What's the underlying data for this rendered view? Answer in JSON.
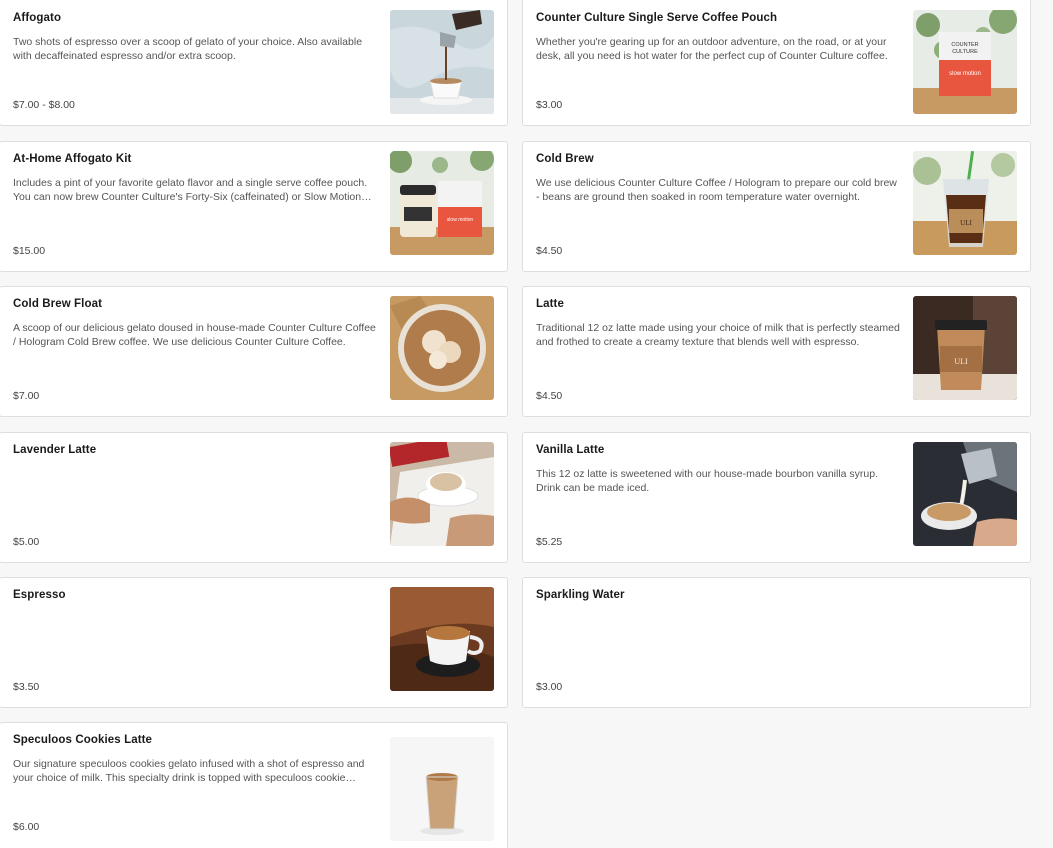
{
  "menu": {
    "items": [
      {
        "name": "Affogato",
        "description": "Two shots of espresso over a scoop of gelato of your choice. Also available with decaffeinated espresso and/or extra scoop.",
        "price": "$7.00 - $8.00",
        "image": "affogato-photo"
      },
      {
        "name": "Counter Culture Single Serve Coffee Pouch",
        "description": "Whether you're gearing up for an outdoor adventure, on the road, or at your desk, all you need is hot water for the perfect cup of Counter Culture coffee.",
        "price": "$3.00",
        "image": "coffee-pouch-photo",
        "image_text": [
          "COUNTER",
          "CULTURE",
          "slow motion"
        ]
      },
      {
        "name": "At-Home Affogato Kit",
        "description": "Includes a pint of your favorite gelato flavor and a single serve coffee pouch. You can now brew Counter Culture's Forty-Six (caffeinated) or Slow Motion (decaf).",
        "price": "$15.00",
        "image": "affogato-kit-photo",
        "image_text": [
          "slow motion"
        ]
      },
      {
        "name": "Cold Brew",
        "description": "We use delicious Counter Culture Coffee / Hologram to prepare our cold brew - beans are ground then soaked in room temperature water overnight.",
        "price": "$4.50",
        "image": "cold-brew-photo",
        "image_text": [
          "ULI"
        ]
      },
      {
        "name": "Cold Brew Float",
        "description": "A scoop of our delicious gelato doused in house-made Counter Culture Coffee / Hologram Cold Brew coffee. We use delicious Counter Culture Coffee.",
        "price": "$7.00",
        "image": "cold-brew-float-photo"
      },
      {
        "name": "Latte",
        "description": "Traditional 12 oz latte made using your choice of milk that is perfectly steamed and frothed to create a creamy texture that blends well with espresso.",
        "price": "$4.50",
        "image": "latte-photo",
        "image_text": [
          "ULI"
        ]
      },
      {
        "name": "Lavender Latte",
        "description": "",
        "price": "$5.00",
        "image": "lavender-latte-photo"
      },
      {
        "name": "Vanilla Latte",
        "description": "This 12 oz latte is sweetened with our house-made bourbon vanilla syrup. Drink can be made iced.",
        "price": "$5.25",
        "image": "vanilla-latte-photo"
      },
      {
        "name": "Espresso",
        "description": "",
        "price": "$3.50",
        "image": "espresso-photo"
      },
      {
        "name": "Sparkling Water",
        "description": "",
        "price": "$3.00",
        "image": ""
      },
      {
        "name": "Speculoos Cookies Latte",
        "description": "Our signature speculoos cookies gelato infused with a shot of espresso and your choice of milk. This specialty drink is topped with speculoos cookie crumbs.",
        "price": "$6.00",
        "image": "speculoos-latte-photo"
      }
    ]
  }
}
